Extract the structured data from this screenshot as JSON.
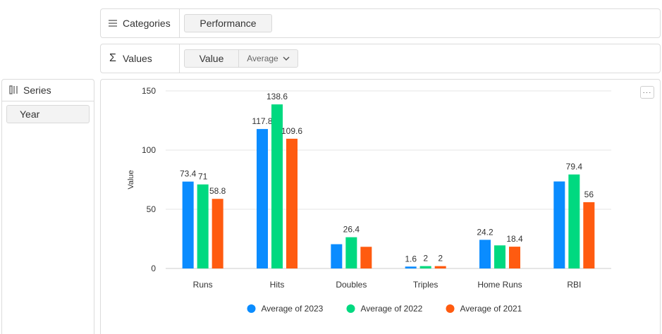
{
  "categories_zone": {
    "label": "Categories",
    "icon": "list-icon",
    "field": "Performance"
  },
  "values_zone": {
    "label": "Values",
    "icon": "sigma-icon",
    "field": "Value",
    "aggregation": "Average"
  },
  "series_zone": {
    "label": "Series",
    "icon": "columns-icon",
    "field": "Year"
  },
  "menu": {
    "more_label": "···"
  },
  "chart_data": {
    "type": "bar",
    "categories": [
      "Runs",
      "Hits",
      "Doubles",
      "Triples",
      "Home Runs",
      "RBI"
    ],
    "series": [
      {
        "name": "Average of 2023",
        "color": "#0a8cff",
        "values": [
          73.4,
          117.8,
          20.5,
          1.6,
          24.2,
          73.5
        ],
        "labels": [
          "73.4",
          "117.8",
          "",
          "1.6",
          "24.2",
          ""
        ]
      },
      {
        "name": "Average of 2022",
        "color": "#00d980",
        "values": [
          71,
          138.6,
          26.4,
          2,
          19.5,
          79.4
        ],
        "labels": [
          "71",
          "138.6",
          "26.4",
          "2",
          "",
          "79.4"
        ]
      },
      {
        "name": "Average of 2021",
        "color": "#ff5b10",
        "values": [
          58.8,
          109.6,
          18.3,
          2,
          18.4,
          56
        ],
        "labels": [
          "58.8",
          "109.6",
          "",
          "2",
          "18.4",
          "56"
        ]
      }
    ],
    "ylabel": "Value",
    "xlabel": "",
    "ylim": [
      0,
      150
    ],
    "yticks": [
      0,
      50,
      100,
      150
    ],
    "grid": true,
    "legend": "bottom"
  }
}
